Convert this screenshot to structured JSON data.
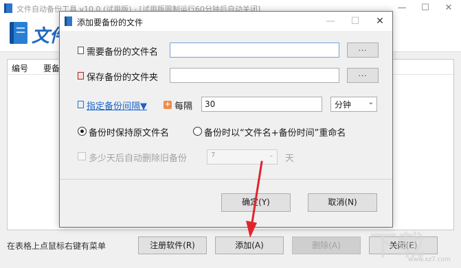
{
  "main_window": {
    "title": "文件自动备份工具 v10.0 (试用版) - [试用版限制运行60分钟后自动关闭]",
    "logo_text": "文件",
    "columns": [
      "编号",
      "要备"
    ],
    "status_hint": "在表格上点鼠标右键有菜单",
    "buttons": {
      "register": "注册软件(R)",
      "add": "添加(A)",
      "delete": "删除(A)",
      "close": "关闭(E)"
    }
  },
  "dialog": {
    "title": "添加要备份的文件",
    "file_label": "需要备份的文件名",
    "file_value": "",
    "folder_label": "保存备份的文件夹",
    "folder_value": "",
    "browse_label": "...",
    "interval_link": "指定备份间隔▼",
    "every_label": "每隔",
    "interval_value": "30",
    "interval_unit": "分钟",
    "radio_keep": "备份时保持原文件名",
    "radio_rename": "备份时以“文件名+备份时间”重命名",
    "radio_selected": "keep",
    "auto_delete_label": "多少天后自动删除旧备份",
    "auto_delete_value": "7",
    "auto_delete_unit": "天",
    "ok": "确定(Y)",
    "cancel": "取消(N)"
  },
  "window_controls": {
    "minimize": "—",
    "maximize": "☐",
    "close": "✕"
  },
  "watermark": {
    "text": "下载",
    "sub": "www.xz7.com"
  },
  "colors": {
    "accent_link": "#1a63c8",
    "annotation_arrow": "#e0242c",
    "logo_blue": "#2068c0"
  }
}
